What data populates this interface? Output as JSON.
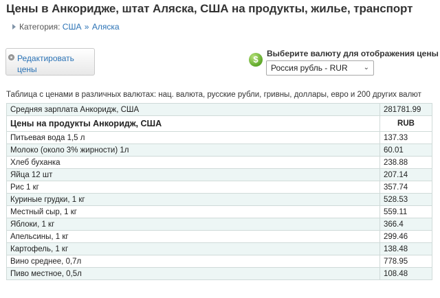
{
  "page": {
    "title": "Цены в Анкоридже, штат Аляска, США на продукты, жилье, транспорт"
  },
  "breadcrumb": {
    "prefix": "Категория:",
    "items": [
      "США",
      "Аляска"
    ],
    "separator": "»"
  },
  "edit_button": {
    "line1": "Редактировать",
    "line2": "цены"
  },
  "currency": {
    "icon": "dollar-coin-icon",
    "icon_glyph": "$",
    "label": "Выберите валюту для отображения цены",
    "selected": "Россия рубль - RUR"
  },
  "table": {
    "caption": "Таблица с ценами в различных валютах: нац. валюта, русские рубли, гривны, доллары, евро и 200 других валют",
    "salary_row": {
      "label": "Средняя зарплата Анкоридж, США",
      "value": "281781.99"
    },
    "section_header": {
      "label": "Цены на продукты Анкоридж, США",
      "currency": "RUB"
    },
    "rows": [
      {
        "label": "Питьевая вода 1,5 л",
        "value": "137.33"
      },
      {
        "label": "Молоко (около 3% жирности) 1л",
        "value": "60.01"
      },
      {
        "label": "Хлеб буханка",
        "value": "238.88"
      },
      {
        "label": "Яйца 12 шт",
        "value": "207.14"
      },
      {
        "label": "Рис 1 кг",
        "value": "357.74"
      },
      {
        "label": "Куриные грудки, 1 кг",
        "value": "528.53"
      },
      {
        "label": "Местный сыр, 1 кг",
        "value": "559.11"
      },
      {
        "label": "Яблоки, 1 кг",
        "value": "366.4"
      },
      {
        "label": "Апельсины, 1 кг",
        "value": "299.46"
      },
      {
        "label": "Картофель, 1 кг",
        "value": "138.48"
      },
      {
        "label": "Вино среднее, 0,7л",
        "value": "778.95"
      },
      {
        "label": "Пиво местное, 0,5л",
        "value": "108.48"
      }
    ]
  },
  "colors": {
    "link": "#2a72b5",
    "row_alt": "#edf6f5",
    "border": "#cfdad8",
    "coin": "#5fa82a"
  }
}
